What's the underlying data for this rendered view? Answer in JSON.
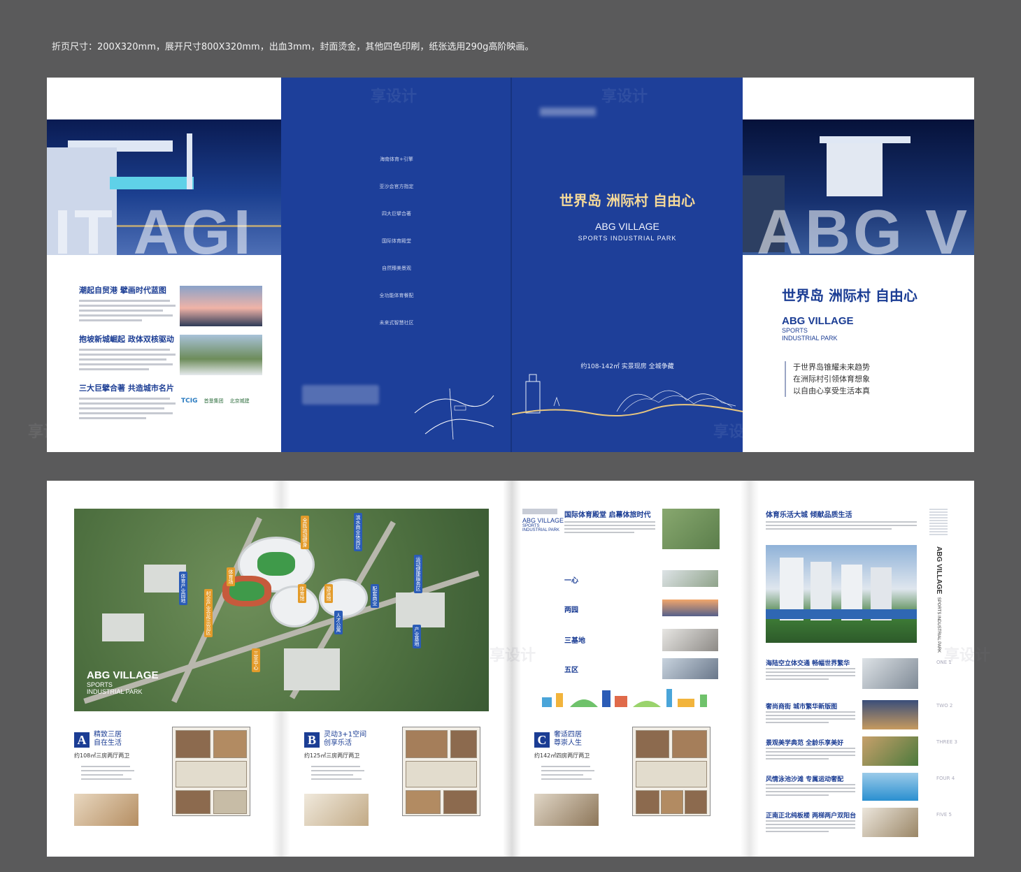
{
  "caption": "折页尺寸：200X320mm，展开尺寸800X320mm，出血3mm，封面烫金，其他四色印刷，纸张选用290g高阶映画。",
  "watermark": "享设计",
  "panel1": {
    "articles": [
      {
        "title": "潮起自贸港 擘画时代蓝图"
      },
      {
        "title": "抱坡新城崛起 政体双核驱动"
      },
      {
        "title": "三大巨擘合著 共造城市名片"
      }
    ],
    "logos": [
      "TCIG",
      "首垦集团",
      "北京城建"
    ]
  },
  "panel2": {
    "menu": [
      "海南体育+引擎",
      "亚沙会官方指定",
      "四大巨擘合著",
      "国际体育殿堂",
      "自然臻美景观",
      "全功能体育餐配",
      "未来式智慧社区"
    ]
  },
  "cover": {
    "title": "世界岛  洲际村  自由心",
    "eng1": "ABG VILLAGE",
    "eng2": "SPORTS  INDUSTRIAL PARK",
    "tag": "约108-142㎡ 实景现房  全城争藏"
  },
  "panel4": {
    "title": "世界岛  洲际村  自由心",
    "eng1": "ABG VILLAGE",
    "eng2": "SPORTS",
    "eng3": "INDUSTRIAL PARK",
    "slogans": [
      "于世界岛锥耀未来趋势",
      "在洲际村引领体育想象",
      "以自由心享受生活本真"
    ]
  },
  "aerial": {
    "title1": "ABG VILLAGE",
    "title2": "SPORTS",
    "title3": "INDUSTRIAL PARK",
    "tags": [
      "体育产业园地",
      "村企产业合作示范区",
      "体育场",
      "体育馆",
      "游泳馆",
      "全民运动健身",
      "滨水商业休闲区",
      "运动健康服务区",
      "人才公寓",
      "产业基地",
      "配套商业",
      "三亚中心"
    ]
  },
  "plans": [
    {
      "letter": "A",
      "name1": "精致三居",
      "name2": "自在生活",
      "area": "约108㎡三房两厅两卫"
    },
    {
      "letter": "B",
      "name1": "灵动3+1空间",
      "name2": "创享乐活",
      "area": "约125㎡三房两厅两卫"
    },
    {
      "letter": "C",
      "name1": "奢适四居",
      "name2": "尊崇人生",
      "area": "约142㎡四房两厅两卫"
    }
  ],
  "mid": {
    "logo1": "ABG VILLAGE",
    "logo2": "SPORTS",
    "logo3": "INDUSTRIAL PARK",
    "title": "国际体育殿堂 启幕体旅时代",
    "rows": [
      "一心",
      "两园",
      "三基地",
      "五区"
    ]
  },
  "right": {
    "title": "体育乐活大城 倾献品质生活",
    "side_logo": "ABG VILLAGE",
    "side_sub": "SPORTS INDUSTRIAL PARK",
    "items": [
      {
        "title": "海陆空立体交通 畅幅世界繁华",
        "page": "ONE 1"
      },
      {
        "title": "奢尚商街 城市繁华新版图",
        "page": "TWO 2"
      },
      {
        "title": "景观美学典范 全龄乐享美好",
        "page": "THREE 3"
      },
      {
        "title": "风情泳池沙滩 专属运动奢配",
        "page": "FOUR 4"
      },
      {
        "title": "正南正北纯板楼 两梯两户双阳台",
        "page": "FIVE 5"
      }
    ]
  },
  "colors": {
    "brand_blue": "#1d3f9a",
    "gold": "#f5d999"
  }
}
